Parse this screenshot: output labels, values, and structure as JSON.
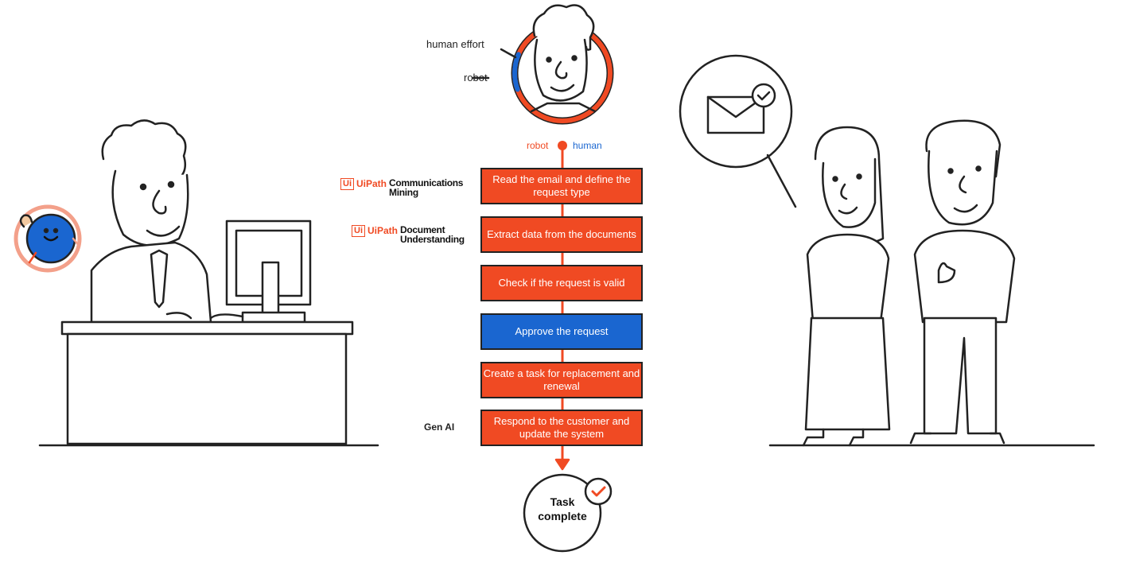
{
  "colors": {
    "robot": "#f04a23",
    "human": "#1a66d0",
    "ink": "#222222"
  },
  "effort_ring": {
    "human_effort_label": "human effort",
    "robot_label": "robot",
    "human_share_percent": 12
  },
  "legend": {
    "robot": "robot",
    "human": "human"
  },
  "steps": [
    {
      "text": "Read the email and define the request type",
      "actor": "robot",
      "tool": {
        "brand": "UiPath",
        "product": "Communications Mining"
      }
    },
    {
      "text": "Extract data from the documents",
      "actor": "robot",
      "tool": {
        "brand": "UiPath",
        "product": "Document Understanding"
      }
    },
    {
      "text": "Check if the request is valid",
      "actor": "robot"
    },
    {
      "text": "Approve the request",
      "actor": "human"
    },
    {
      "text": "Create a task for replacement and renewal",
      "actor": "robot"
    },
    {
      "text": "Respond to the customer and update the system",
      "actor": "robot",
      "tool_label": "Gen AI"
    }
  ],
  "end": {
    "label": "Task complete",
    "icon": "check-icon"
  },
  "illustrations": {
    "left": "worker-at-desk",
    "right": "two-customers-with-email-bubble",
    "bubble_icon": "envelope-check-icon",
    "mascot": "blue-robot-mascot"
  }
}
